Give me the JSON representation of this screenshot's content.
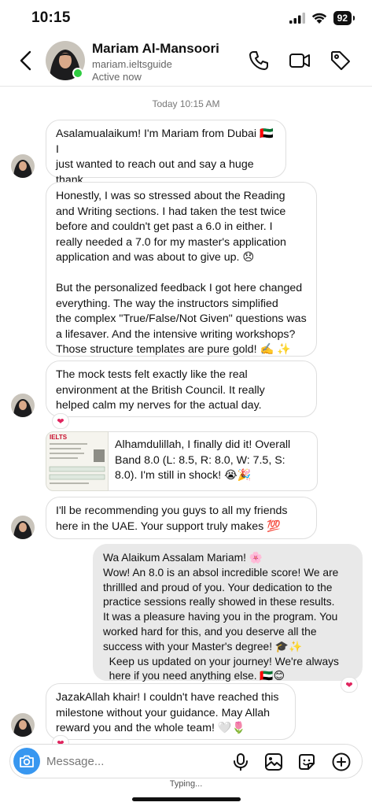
{
  "status": {
    "time": "10:15",
    "battery": "92"
  },
  "contact": {
    "name": "Mariam Al-Mansoori",
    "handle": "mariam.ieltsguide",
    "status": "Active now"
  },
  "timestamp": "Today 10:15 AM",
  "messages": [
    {
      "text": "Asalamualaikum! I'm Mariam from Dubai 🇦🇪 I\njust wanted to reach out and say a huge thank\nyou to the IELTS Mania team! 😊"
    },
    {
      "text": "Honestly, I was so stressed about the Reading\nand Writing sections. I had taken the test twice\nbefore and couldn't get past a 6.0 in either. I\nreally needed a 7.0 for my master's application\napplication and was about to give up. 😞\n\nBut the personalized feedback I got here changed\neverything. The way the instructors simplified\nthe complex \"True/False/Not Given\" questions was\na lifesaver. And the intensive writing workshops?\nThose structure templates are pure gold! ✍️ ✨"
    },
    {
      "text": "The mock tests felt exactly like the real\nenvironment at the British Council. It really\nhelped calm my nerves for the actual day.",
      "reaction": "❤"
    },
    {
      "text": "Alhamdulillah, I finally did it! Overall\nBand 8.0 (L: 8.5, R: 8.0, W: 7.5, S:\n8.0). I'm still in shock! 😭🎉",
      "image_label": "IELTS"
    },
    {
      "text": "I'll be recommending you guys to all my friends\nhere in the UAE. Your support truly makes 💯"
    },
    {
      "text": "Wa Alaikum Assalam Mariam! 🌸\nWow! An 8.0 is an absol incredible score! We are\nthrillled and proud of you. Your dedication to the\npractice sessions really showed in these results.\nIt was a pleasure having you in the program. You\nworked hard for this, and you deserve all the\nsuccess with your Master's degree! 🎓✨\n  Keep us updated on your journey! We're always\n  here if you need anything else. 🇦🇪😊",
      "reaction": "❤"
    },
    {
      "text": "JazakAllah khair! I couldn't have reached this\nmilestone without your guidance. May Allah\nreward you and the whole team! 🤍🌷",
      "reaction": "❤"
    }
  ],
  "composer": {
    "placeholder": "Message...",
    "typing": "Typing..."
  }
}
